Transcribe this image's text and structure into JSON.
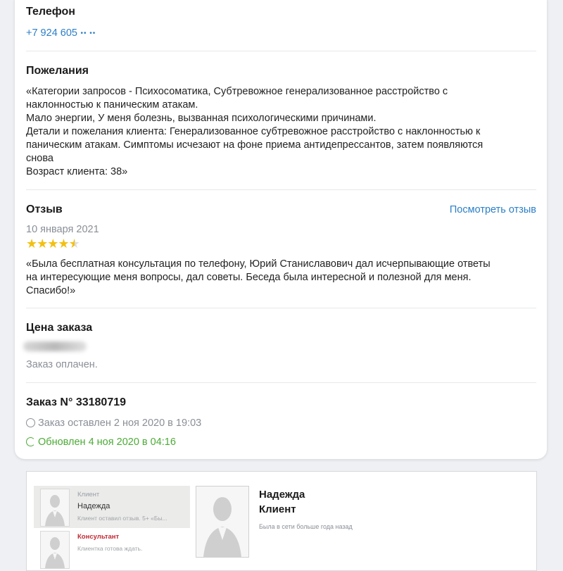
{
  "phone": {
    "heading": "Телефон",
    "value": "+7 924 605",
    "masked": "•• ••"
  },
  "wishes": {
    "heading": "Пожелания",
    "lines": [
      "«Категории запросов - Психосоматика, Субтревожное генерализованное расстройство с",
      "наклонностью к паническим атакам.",
      "Мало энергии, У меня болезнь, вызванная психологическими причинами.",
      "Детали и пожелания клиента: Генерализованное субтревожное расстройство с наклонностью к",
      "паническим атакам. Симптомы исчезают на фоне приема антидепрессантов, затем появляются",
      "снова",
      "Возраст клиента: 38»"
    ]
  },
  "review": {
    "heading": "Отзыв",
    "view_link": "Посмотреть отзыв",
    "date": "10 января 2021",
    "rating": 4.5,
    "rating_max": 5,
    "lines": [
      "«Была бесплатная консультация по телефону, Юрий Станиславович дал исчерпывающие ответы",
      "на интересующие меня вопросы, дал советы. Беседа была интересной и полезной для меня.",
      "Спасибо!»"
    ]
  },
  "price": {
    "heading": "Цена заказа",
    "status": "Заказ оплачен."
  },
  "order": {
    "title": "Заказ N° 33180719",
    "placed": "Заказ оставлен 2 ноя 2020 в 19:03",
    "updated": "Обновлен 4 ноя 2020 в 04:16"
  },
  "chat": {
    "items": [
      {
        "role": "Клиент",
        "name": "Надежда",
        "snippet": "Клиент оставил отзыв. 5+ «Бы..."
      },
      {
        "role": "Консультант",
        "name": "",
        "snippet": "Клиентка готова ждать."
      }
    ],
    "profile": {
      "name": "Надежда",
      "role": "Клиент",
      "status": "Была в сети больше года назад"
    }
  },
  "colors": {
    "link": "#2b7fc7",
    "star": "#f2c014",
    "updated_green": "#4bab35",
    "consultant_red": "#c22833"
  }
}
